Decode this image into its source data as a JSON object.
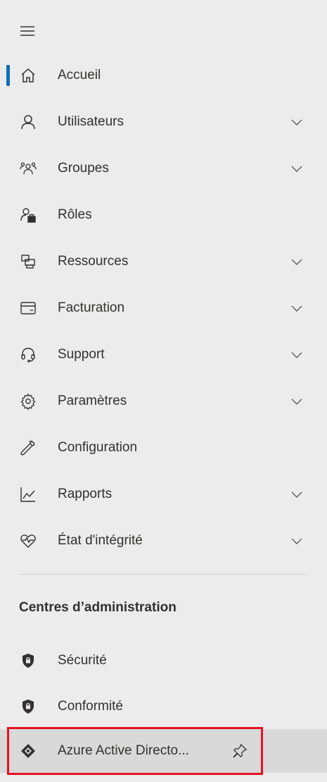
{
  "nav": {
    "items": [
      {
        "label": "Accueil",
        "icon": "home-icon",
        "expandable": false,
        "selected": true
      },
      {
        "label": "Utilisateurs",
        "icon": "user-icon",
        "expandable": true
      },
      {
        "label": "Groupes",
        "icon": "groups-icon",
        "expandable": true
      },
      {
        "label": "Rôles",
        "icon": "roles-icon",
        "expandable": false
      },
      {
        "label": "Ressources",
        "icon": "resources-icon",
        "expandable": true
      },
      {
        "label": "Facturation",
        "icon": "billing-icon",
        "expandable": true
      },
      {
        "label": "Support",
        "icon": "headset-icon",
        "expandable": true
      },
      {
        "label": "Paramètres",
        "icon": "gear-icon",
        "expandable": true
      },
      {
        "label": "Configuration",
        "icon": "wrench-icon",
        "expandable": false
      },
      {
        "label": "Rapports",
        "icon": "chart-icon",
        "expandable": true
      },
      {
        "label": "État d'intégrité",
        "icon": "heart-pulse-icon",
        "expandable": true
      }
    ],
    "admin_section": {
      "title": "Centres d’administration",
      "items": [
        {
          "label": "Sécurité",
          "icon": "shield-lock-icon"
        },
        {
          "label": "Conformité",
          "icon": "shield-lock-icon"
        },
        {
          "label": "Azure Active Directo...",
          "icon": "azure-ad-icon",
          "pinned_icon": "pin-icon",
          "highlighted": true
        }
      ]
    }
  },
  "colors": {
    "background": "#ececec",
    "accent": "#0f6cbd",
    "highlight": "#d9d9d9",
    "annotation_box": "#e81123"
  }
}
